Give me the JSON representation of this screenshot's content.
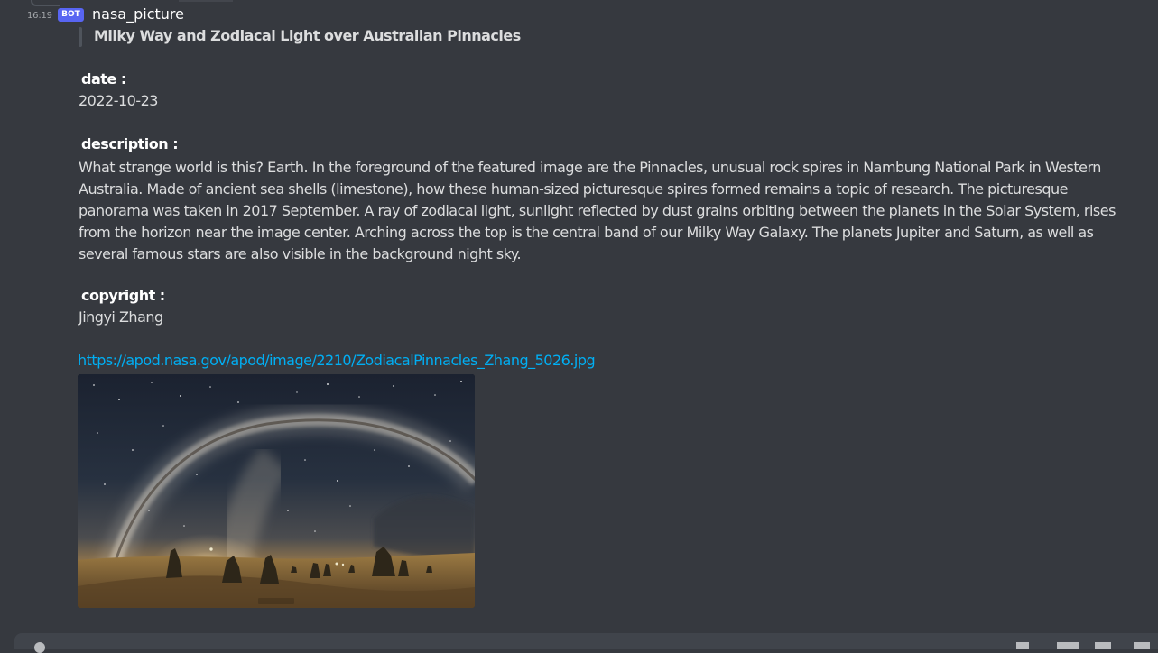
{
  "message": {
    "timestamp": "16:19",
    "bot_tag": "BOT",
    "username": "nasa_picture",
    "title": "Milky Way and Zodiacal Light over Australian Pinnacles",
    "date_label": "date :",
    "date_value": "2022-10-23",
    "description_label": "description :",
    "description_text": "What strange world is this? Earth. In the foreground of the featured image are the Pinnacles, unusual rock spires in Nambung National Park in Western Australia. Made of ancient sea shells (limestone), how these human-sized picturesque spires formed remains a topic of research.  The picturesque panorama was taken in 2017 September.   A ray of zodiacal light, sunlight reflected by dust grains orbiting between the planets in the Solar System, rises from the horizon near the image center. Arching across the top is the central band of our Milky Way Galaxy. The planets Jupiter and Saturn, as well as several famous stars are also visible in the background night sky.",
    "copyright_label": "copyright :",
    "copyright_value": "Jingyi Zhang",
    "image_url": "https://apod.nasa.gov/apod/image/2210/ZodiacalPinnacles_Zhang_5026.jpg",
    "image_caption": "Milky Way and Zodiacal Light over Australian Pinnacles"
  },
  "colors": {
    "background": "#36393f",
    "bot_tag": "#5865f2",
    "link": "#00aff4",
    "text": "#dcddde",
    "input_bar": "#40444b"
  },
  "icons": {
    "reply": "reply-icon",
    "add": "add-icon",
    "gift": "gift-icon",
    "gif": "gif-icon",
    "sticker": "sticker-icon",
    "emoji": "emoji-icon"
  }
}
